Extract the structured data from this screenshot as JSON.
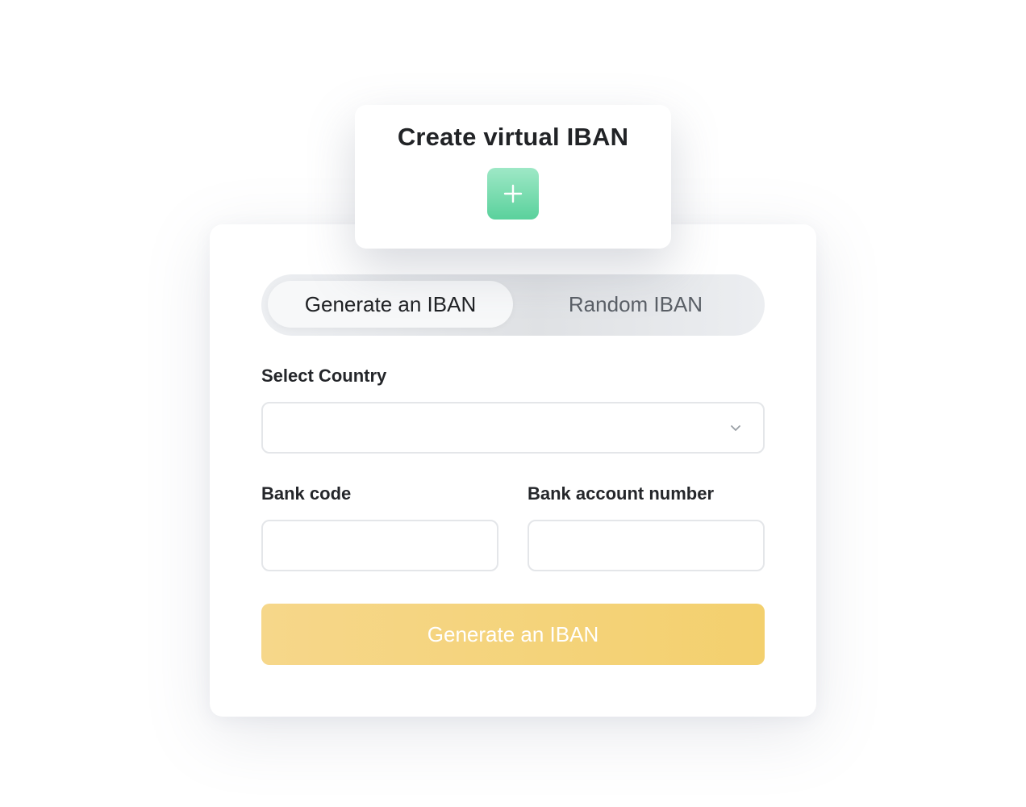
{
  "header": {
    "title": "Create virtual IBAN",
    "add_icon": "plus-icon",
    "add_button_color": "#5ad19c"
  },
  "mode_toggle": {
    "options": [
      {
        "label": "Generate an IBAN",
        "active": true
      },
      {
        "label": "Random IBAN",
        "active": false
      }
    ]
  },
  "form": {
    "country": {
      "label": "Select Country",
      "value": "",
      "icon": "chevron-down-icon"
    },
    "bank_code": {
      "label": "Bank code",
      "value": ""
    },
    "account_number": {
      "label": "Bank account number",
      "value": ""
    },
    "submit": {
      "label": "Generate an IBAN",
      "color": "#f3d06e"
    }
  }
}
